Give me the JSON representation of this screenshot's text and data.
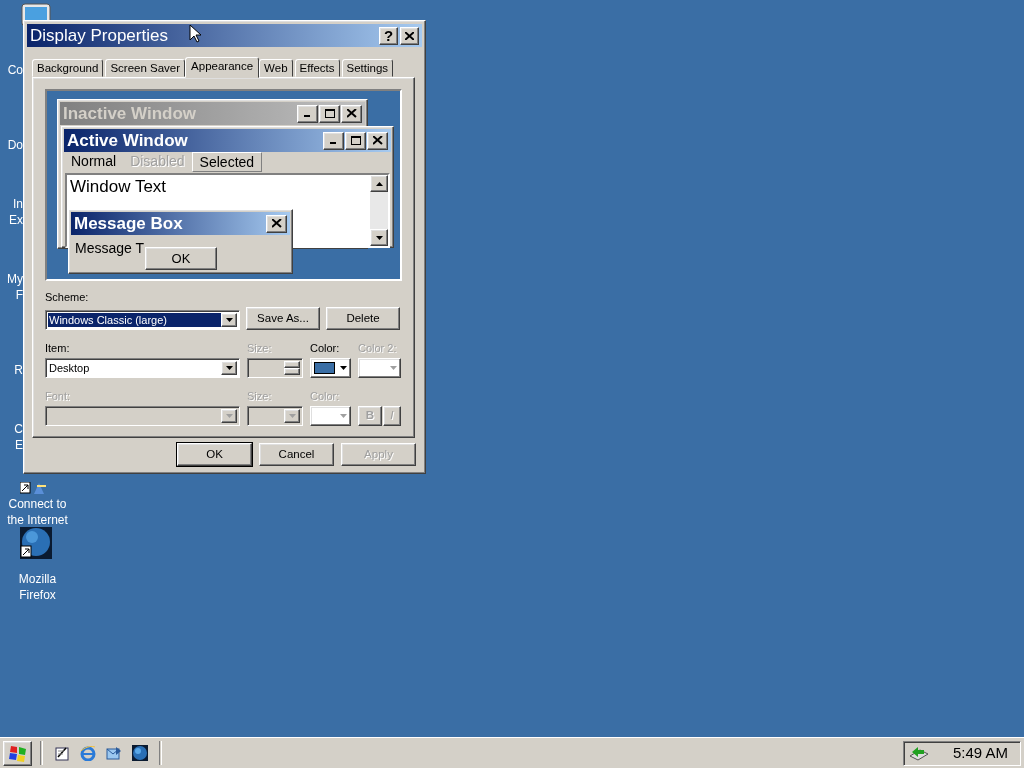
{
  "desktop": {
    "icons": [
      {
        "kind": "monitor",
        "lines": [
          "Co"
        ]
      },
      {
        "kind": "hidden",
        "lines": [
          "Do"
        ]
      },
      {
        "kind": "hidden",
        "lines": [
          "In",
          "Ex"
        ]
      },
      {
        "kind": "hidden",
        "lines": [
          "My",
          "F"
        ]
      },
      {
        "kind": "hidden",
        "lines": [
          "R"
        ]
      },
      {
        "kind": "hidden",
        "lines": [
          "C",
          "E"
        ]
      },
      {
        "kind": "connect",
        "lines": [
          "Connect to",
          "the Internet"
        ]
      },
      {
        "kind": "globe",
        "lines": [
          "Mozilla",
          "Firefox"
        ]
      }
    ]
  },
  "dialog": {
    "title": "Display Properties",
    "help_button": "?",
    "tabs": [
      {
        "label": "Background",
        "selected": false
      },
      {
        "label": "Screen Saver",
        "selected": false
      },
      {
        "label": "Appearance",
        "selected": true
      },
      {
        "label": "Web",
        "selected": false
      },
      {
        "label": "Effects",
        "selected": false
      },
      {
        "label": "Settings",
        "selected": false
      }
    ],
    "preview": {
      "inactive_title": "Inactive Window",
      "active_title": "Active Window",
      "menu": [
        {
          "label": "Normal",
          "disabled": false,
          "selected": false
        },
        {
          "label": "Disabled",
          "disabled": true,
          "selected": false
        },
        {
          "label": "Selected",
          "disabled": false,
          "selected": true
        }
      ],
      "window_text": "Window Text",
      "message_box": {
        "title": "Message Box",
        "text": "Message T",
        "button": "OK"
      }
    },
    "scheme": {
      "label": "Scheme:",
      "value": "Windows Classic (large)",
      "buttons": [
        "Save As...",
        "Delete"
      ]
    },
    "item_row": [
      {
        "kind": "combo",
        "label": "Item:",
        "value": "Desktop",
        "disabled": false
      },
      {
        "kind": "spin",
        "label": "Size:",
        "disabled": true
      },
      {
        "kind": "color",
        "label": "Color:",
        "color": "#3a6ea5",
        "disabled": false
      },
      {
        "kind": "color",
        "label": "Color 2:",
        "disabled": true
      }
    ],
    "font_row": [
      {
        "kind": "combo",
        "label": "Font:",
        "disabled": true
      },
      {
        "kind": "combo",
        "label": "Size:",
        "disabled": true
      },
      {
        "kind": "color",
        "label": "Color:",
        "disabled": true
      },
      {
        "kind": "toggles",
        "buttons": [
          "B",
          "I"
        ],
        "disabled": true
      }
    ],
    "buttons": [
      {
        "label": "OK",
        "disabled": false
      },
      {
        "label": "Cancel",
        "disabled": false
      },
      {
        "label": "Apply",
        "disabled": true
      }
    ]
  },
  "taskbar": {
    "quick_launch": [
      {
        "kind": "notepad"
      },
      {
        "kind": "browser"
      },
      {
        "kind": "mail"
      },
      {
        "kind": "globe"
      }
    ],
    "clock": "5:49 AM"
  }
}
